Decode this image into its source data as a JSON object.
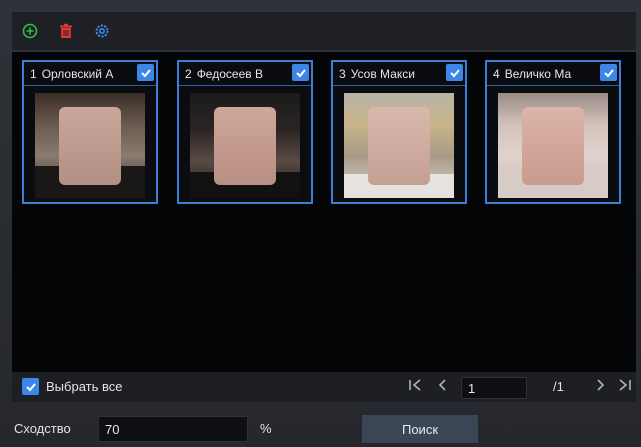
{
  "toolbar": {
    "add_icon": "add-circle-icon",
    "delete_icon": "trash-icon",
    "settings_icon": "gear-icon",
    "colors": {
      "add": "#2fbf4a",
      "delete": "#e53935",
      "settings": "#3b86e6"
    }
  },
  "faces": [
    {
      "num": "1",
      "name": "Орловский А",
      "checked": true
    },
    {
      "num": "2",
      "name": "Федосеев В",
      "checked": true
    },
    {
      "num": "3",
      "name": "Усов Макси",
      "checked": true
    },
    {
      "num": "4",
      "name": "Величко Ма",
      "checked": true
    }
  ],
  "footer": {
    "select_all_label": "Выбрать все",
    "select_all_checked": true,
    "first_icon": "first-page-icon",
    "prev_icon": "prev-page-icon",
    "next_icon": "next-page-icon",
    "last_icon": "last-page-icon",
    "page_value": "1",
    "page_total": "/1"
  },
  "search": {
    "similarity_label": "Сходство",
    "similarity_value": "70",
    "similarity_unit": "%",
    "search_label": "Поиск"
  },
  "colors": {
    "accent": "#3b86e6",
    "card_border": "#3d7fd6",
    "grid_bg": "#040507"
  }
}
